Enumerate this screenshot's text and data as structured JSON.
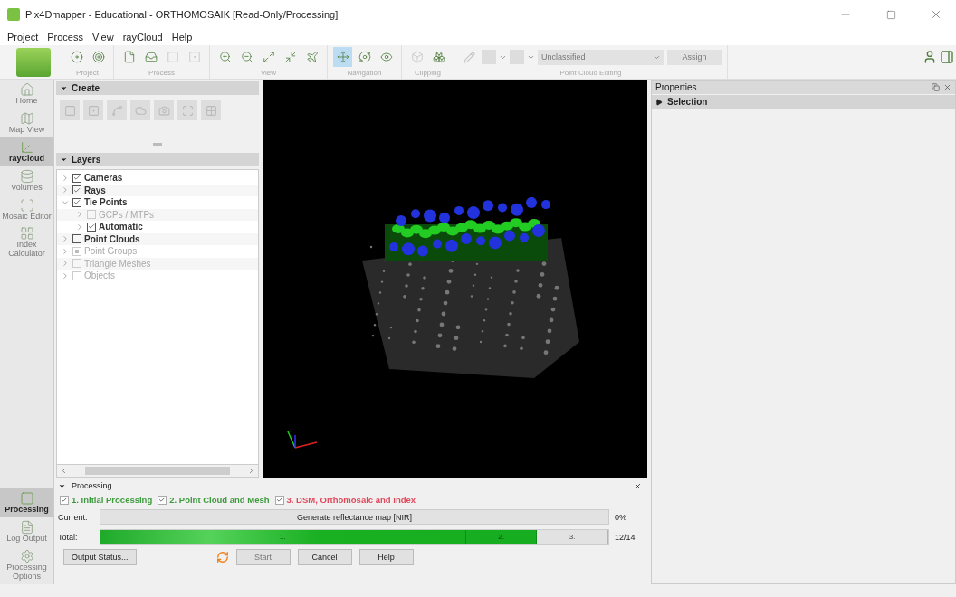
{
  "window": {
    "title": "Pix4Dmapper - Educational - ORTHOMOSAIK [Read-Only/Processing]"
  },
  "menu": [
    "Project",
    "Process",
    "View",
    "rayCloud",
    "Help"
  ],
  "toolbar": {
    "groups": [
      {
        "label": "Project",
        "tools": [
          {
            "kind": "disc",
            "selected": false,
            "disabled": false
          },
          {
            "kind": "target",
            "selected": false,
            "disabled": false
          }
        ]
      },
      {
        "label": "Process",
        "tools": [
          {
            "kind": "file",
            "selected": false,
            "disabled": false
          },
          {
            "kind": "inbox",
            "selected": false,
            "disabled": false
          },
          {
            "kind": "square",
            "selected": false,
            "disabled": true
          },
          {
            "kind": "square-dot",
            "selected": false,
            "disabled": true
          }
        ]
      },
      {
        "label": "View",
        "tools": [
          {
            "kind": "zoom-in",
            "selected": false,
            "disabled": false
          },
          {
            "kind": "zoom-out",
            "selected": false,
            "disabled": false
          },
          {
            "kind": "expand",
            "selected": false,
            "disabled": false
          },
          {
            "kind": "shrink",
            "selected": false,
            "disabled": false
          },
          {
            "kind": "plane",
            "selected": false,
            "disabled": false
          }
        ]
      },
      {
        "label": "Navigation",
        "tools": [
          {
            "kind": "move",
            "selected": true,
            "disabled": false
          },
          {
            "kind": "orbit",
            "selected": false,
            "disabled": false
          },
          {
            "kind": "eye",
            "selected": false,
            "disabled": false
          }
        ]
      },
      {
        "label": "Clipping",
        "tools": [
          {
            "kind": "box",
            "selected": false,
            "disabled": true
          },
          {
            "kind": "boxes",
            "selected": false,
            "disabled": false
          }
        ]
      }
    ],
    "editing": {
      "label": "Point Cloud Editing",
      "combo": {
        "value": "Unclassified",
        "disabled": true
      },
      "button": {
        "label": "Assign",
        "disabled": true
      }
    }
  },
  "nav": [
    {
      "label": "Home",
      "kind": "home",
      "selected": false
    },
    {
      "label": "Map View",
      "kind": "map",
      "selected": false
    },
    {
      "label": "rayCloud",
      "kind": "cloud",
      "selected": true
    },
    {
      "label": "Volumes",
      "kind": "volume",
      "selected": false
    },
    {
      "label": "Mosaic Editor",
      "kind": "mosaic",
      "selected": false
    },
    {
      "label": "Index Calculator",
      "kind": "grid",
      "selected": false
    }
  ],
  "nav_bottom": [
    {
      "label": "Processing",
      "kind": "square",
      "selected": true
    },
    {
      "label": "Log Output",
      "kind": "log",
      "selected": false
    },
    {
      "label": "Processing Options",
      "kind": "gear",
      "selected": false
    }
  ],
  "create": {
    "title": "Create",
    "expanded": true,
    "tools": [
      {
        "kind": "rect"
      },
      {
        "kind": "square"
      },
      {
        "kind": "axes"
      },
      {
        "kind": "cloud"
      },
      {
        "kind": "camera"
      },
      {
        "kind": "line"
      },
      {
        "kind": "grid"
      }
    ]
  },
  "layers": {
    "title": "Layers",
    "expanded": true,
    "items": [
      {
        "label": "Cameras",
        "checked": true,
        "disabled": false,
        "expanded": false
      },
      {
        "label": "Rays",
        "checked": true,
        "disabled": false,
        "expanded": false
      },
      {
        "label": "Tie Points",
        "checked": true,
        "disabled": false,
        "expanded": true,
        "children": [
          {
            "label": "GCPs / MTPs",
            "checked": false,
            "disabled": true,
            "expanded": false
          },
          {
            "label": "Automatic",
            "checked": true,
            "disabled": false,
            "expanded": false
          }
        ]
      },
      {
        "label": "Point Clouds",
        "checked": false,
        "disabled": false,
        "expanded": false
      },
      {
        "label": "Point Groups",
        "checked": true,
        "disabled": true,
        "expanded": false
      },
      {
        "label": "Triangle Meshes",
        "checked": false,
        "disabled": true,
        "expanded": false
      },
      {
        "label": "Objects",
        "checked": false,
        "disabled": true,
        "expanded": false
      }
    ]
  },
  "processing": {
    "title": "Processing",
    "expanded": true,
    "steps": [
      {
        "label": "1. Initial Processing",
        "checked": true,
        "color": "#3c9a3c"
      },
      {
        "label": "2. Point Cloud and Mesh",
        "checked": true,
        "color": "#3c9a3c"
      },
      {
        "label": "3. DSM, Orthomosaic and Index",
        "checked": true,
        "color": "#e0485a"
      }
    ],
    "current": {
      "label": "Current:",
      "task": "Generate reflectance map [NIR]",
      "level": 0,
      "reading": "0%"
    },
    "total": {
      "label": "Total:",
      "segments": [
        "1.",
        "2.",
        "3."
      ],
      "level": 0.86,
      "reading": "12/14"
    },
    "buttons": [
      {
        "label": "Output Status...",
        "disabled": false
      },
      {
        "label": "Start",
        "disabled": true
      },
      {
        "label": "Cancel",
        "disabled": false
      },
      {
        "label": "Help",
        "disabled": false
      }
    ]
  },
  "properties": {
    "title": "Properties",
    "sections": [
      {
        "label": "Selection",
        "expanded": false
      }
    ]
  }
}
